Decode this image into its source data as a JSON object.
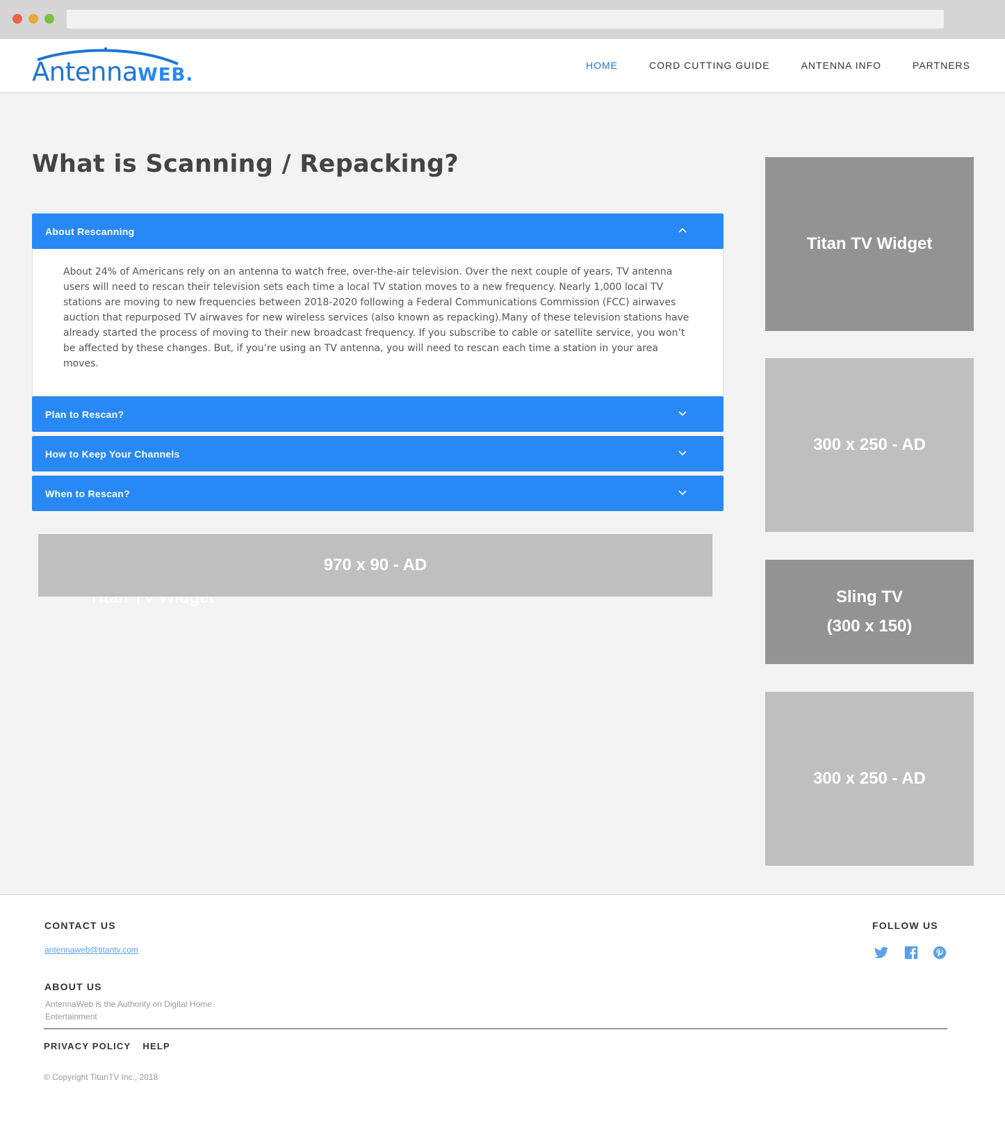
{
  "site": {
    "logo_text_main": "Antenna",
    "logo_text_web": "WEB."
  },
  "nav": {
    "items": [
      {
        "label": "HOME",
        "active": true
      },
      {
        "label": "CORD CUTTING GUIDE",
        "active": false
      },
      {
        "label": "ANTENNA INFO",
        "active": false
      },
      {
        "label": "PARTNERS",
        "active": false
      }
    ]
  },
  "main": {
    "title": "What is Scanning / Repacking?",
    "accordion": [
      {
        "label": "About Rescanning",
        "expanded": true,
        "body": "About 24% of Americans rely on an antenna to watch free, over-the-air television. Over the next couple of years, TV antenna users will need to rescan their television sets each time a local TV station moves to a new frequency. Nearly 1,000 local TV stations are moving to new frequencies between 2018-2020 following a Federal Communications Commission (FCC) airwaves auction that repurposed TV airwaves for new wireless services (also known as repacking).Many of these television stations have already started the process of moving to their new broadcast frequency. If you subscribe to cable or satellite service, you won’t be affected by these changes. But, if you’re using an TV antenna, you will need to rescan each time a station in your area moves."
      },
      {
        "label": "Plan to Rescan?",
        "expanded": false
      },
      {
        "label": "How to Keep Your Channels",
        "expanded": false
      },
      {
        "label": "When to Rescan?",
        "expanded": false
      }
    ],
    "wide_ad": "970 x 90 - AD",
    "ghost_text": "Titan TV Widget"
  },
  "sidebar": {
    "box1": "Titan TV Widget",
    "box2": "300 x 250 - AD",
    "box3_line1": "Sling TV",
    "box3_line2": "(300 x 150)",
    "box4": "300 x 250 - AD"
  },
  "footer": {
    "contact_heading": "CONTACT US",
    "email": "antennaweb@titantv.com",
    "about_heading": "ABOUT US",
    "about_text": "AntennaWeb is the Authority on Digital Home Entertainment",
    "follow_heading": "FOLLOW US",
    "links": [
      "PRIVACY POLICY",
      "HELP"
    ],
    "copyright": "© Copyright TitanTV Inc., 2018"
  },
  "colors": {
    "accent": "#2888f5",
    "nav_active": "#1f74d8",
    "link": "#5aa0ea",
    "ad_dark": "#939393",
    "ad_light": "#bfbfbf"
  },
  "icons": {
    "social": [
      "twitter-icon",
      "facebook-icon",
      "pinterest-icon"
    ],
    "accordion_open": "chevron-up-icon",
    "accordion_closed": "chevron-down-icon"
  }
}
